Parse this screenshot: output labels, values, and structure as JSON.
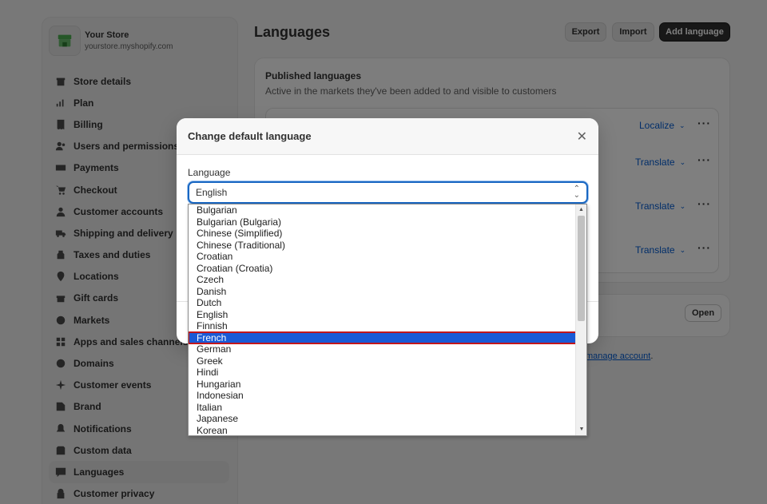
{
  "store": {
    "name": "Your Store",
    "url": "yourstore.myshopify.com"
  },
  "sidebar": {
    "items": [
      {
        "label": "Store details",
        "icon": "store-icon"
      },
      {
        "label": "Plan",
        "icon": "chart-icon"
      },
      {
        "label": "Billing",
        "icon": "receipt-icon"
      },
      {
        "label": "Users and permissions",
        "icon": "users-icon"
      },
      {
        "label": "Payments",
        "icon": "payments-icon"
      },
      {
        "label": "Checkout",
        "icon": "cart-icon"
      },
      {
        "label": "Customer accounts",
        "icon": "person-icon"
      },
      {
        "label": "Shipping and delivery",
        "icon": "truck-icon"
      },
      {
        "label": "Taxes and duties",
        "icon": "tax-icon"
      },
      {
        "label": "Locations",
        "icon": "location-icon"
      },
      {
        "label": "Gift cards",
        "icon": "gift-icon"
      },
      {
        "label": "Markets",
        "icon": "globe-icon"
      },
      {
        "label": "Apps and sales channels",
        "icon": "apps-icon"
      },
      {
        "label": "Domains",
        "icon": "domain-icon"
      },
      {
        "label": "Customer events",
        "icon": "sparkle-icon"
      },
      {
        "label": "Brand",
        "icon": "brand-icon"
      },
      {
        "label": "Notifications",
        "icon": "bell-icon"
      },
      {
        "label": "Custom data",
        "icon": "database-icon"
      },
      {
        "label": "Languages",
        "icon": "language-icon",
        "active": true
      },
      {
        "label": "Customer privacy",
        "icon": "lock-icon"
      }
    ]
  },
  "header": {
    "title": "Languages",
    "export_label": "Export",
    "import_label": "Import",
    "add_label": "Add language"
  },
  "published": {
    "title": "Published languages",
    "subtitle": "Active in the markets they've been added to and visible to customers",
    "rows": [
      {
        "action": "Localize"
      },
      {
        "action": "Translate"
      },
      {
        "action": "Translate"
      },
      {
        "action": "Translate"
      }
    ]
  },
  "second_card": {
    "open_label": "Open"
  },
  "manage_link": {
    "text": "manage account",
    "suffix": "."
  },
  "modal": {
    "title": "Change default language",
    "field_label": "Language",
    "selected_value": "English"
  },
  "dropdown": {
    "options": [
      "Bulgarian",
      "Bulgarian (Bulgaria)",
      "Chinese (Simplified)",
      "Chinese (Traditional)",
      "Croatian",
      "Croatian (Croatia)",
      "Czech",
      "Danish",
      "Dutch",
      "English",
      "Finnish",
      "French",
      "German",
      "Greek",
      "Hindi",
      "Hungarian",
      "Indonesian",
      "Italian",
      "Japanese",
      "Korean"
    ],
    "highlighted": "French"
  },
  "colors": {
    "accent": "#1a5ad6",
    "link": "#005bd3",
    "highlight_border": "#c2161b",
    "primary_button": "#303030"
  }
}
